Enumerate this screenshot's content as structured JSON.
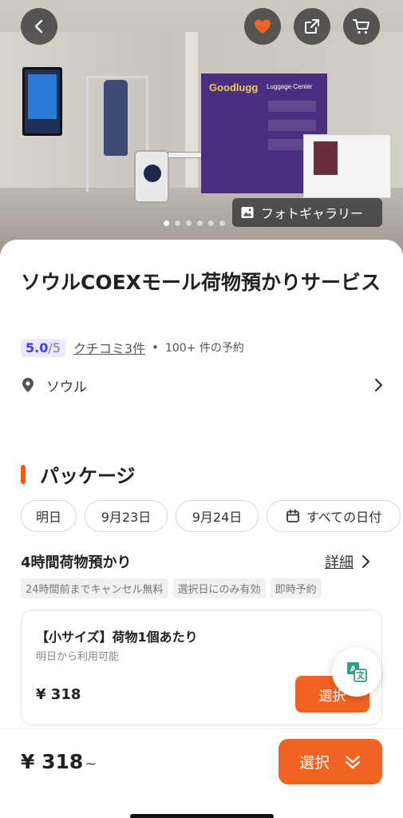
{
  "hero": {
    "gallery_label": "フォトギャラリー",
    "photo_count": 6,
    "active_photo": 1,
    "panel_logo": "Goodlugg",
    "panel_title": "Luggage Center"
  },
  "product": {
    "title": "ソウルCOEXモール荷物預かりサービス",
    "rating_value": "5.0",
    "rating_max": "/5",
    "reviews": "クチコミ3件",
    "separator": "•",
    "bookings": "100+ 件の予約",
    "location": "ソウル"
  },
  "packages": {
    "heading": "パッケージ",
    "dates": [
      "明日",
      "9月23日",
      "9月24日",
      "すべての日付"
    ],
    "name": "4時間荷物預かり",
    "detail_label": "詳細",
    "tags": [
      "24時間前までキャンセル無料",
      "選択日にのみ有効",
      "即時予約"
    ],
    "offer": {
      "title": "【小サイズ】荷物1個あたり",
      "subtitle": "明日から利用可能",
      "price": "¥ 318",
      "button": "選択"
    }
  },
  "footer": {
    "price": "¥ 318",
    "price_suffix": "~",
    "button": "選択"
  },
  "colors": {
    "accent": "#f26322",
    "section_bar": "#ff5b00",
    "rating_bg": "#ebe8ff",
    "rating_text": "#3d3df5"
  },
  "icons": [
    "back-icon",
    "heart-icon",
    "share-icon",
    "cart-icon",
    "image-icon",
    "location-pin-icon",
    "chevron-right-icon",
    "calendar-icon",
    "translate-icon",
    "chevron-double-down-icon"
  ]
}
